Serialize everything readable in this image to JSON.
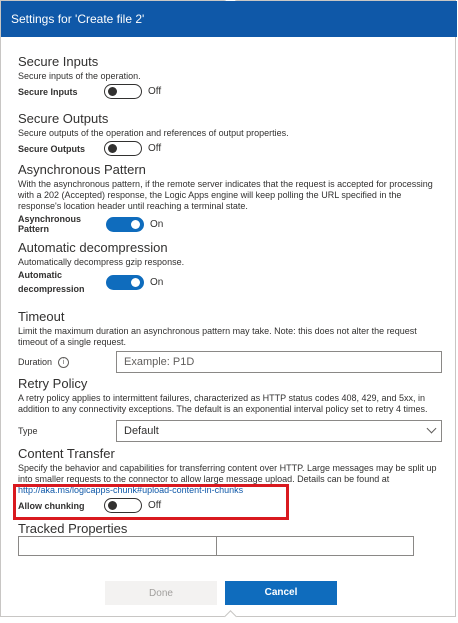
{
  "dialog": {
    "title": "Settings for 'Create file 2'"
  },
  "secure_inputs": {
    "title": "Secure Inputs",
    "desc": "Secure inputs of the operation.",
    "label": "Secure Inputs",
    "state": "Off"
  },
  "secure_outputs": {
    "title": "Secure Outputs",
    "desc": "Secure outputs of the operation and references of output properties.",
    "label": "Secure Outputs",
    "state": "Off"
  },
  "async": {
    "title": "Asynchronous Pattern",
    "desc": "With the asynchronous pattern, if the remote server indicates that the request is accepted for processing with a 202 (Accepted) response, the Logic Apps engine will keep polling the URL specified in the response's location header until reaching a terminal state.",
    "label": "Asynchronous Pattern",
    "state": "On"
  },
  "decompression": {
    "title": "Automatic decompression",
    "desc": "Automatically decompress gzip response.",
    "label": "Automatic decompression",
    "state": "On"
  },
  "timeout": {
    "title": "Timeout",
    "desc": "Limit the maximum duration an asynchronous pattern may take. Note: this does not alter the request timeout of a single request.",
    "label": "Duration",
    "info": "i",
    "placeholder": "Example: P1D"
  },
  "retry": {
    "title": "Retry Policy",
    "desc": "A retry policy applies to intermittent failures, characterized as HTTP status codes 408, 429, and 5xx, in addition to any connectivity exceptions. The default is an exponential interval policy set to retry 4 times.",
    "label": "Type",
    "value": "Default"
  },
  "content_transfer": {
    "title": "Content Transfer",
    "desc": "Specify the behavior and capabilities for transferring content over HTTP. Large messages may be split up into smaller requests to the connector to allow large message upload. Details can be found at",
    "link": "http://aka.ms/logicapps-chunk#upload-content-in-chunks",
    "label": "Allow chunking",
    "state": "Off"
  },
  "tracked": {
    "title": "Tracked Properties"
  },
  "footer": {
    "done": "Done",
    "cancel": "Cancel"
  },
  "colors": {
    "header": "#0f58a8",
    "toggle_on": "#0f6cbd",
    "highlight": "#d9191f"
  }
}
